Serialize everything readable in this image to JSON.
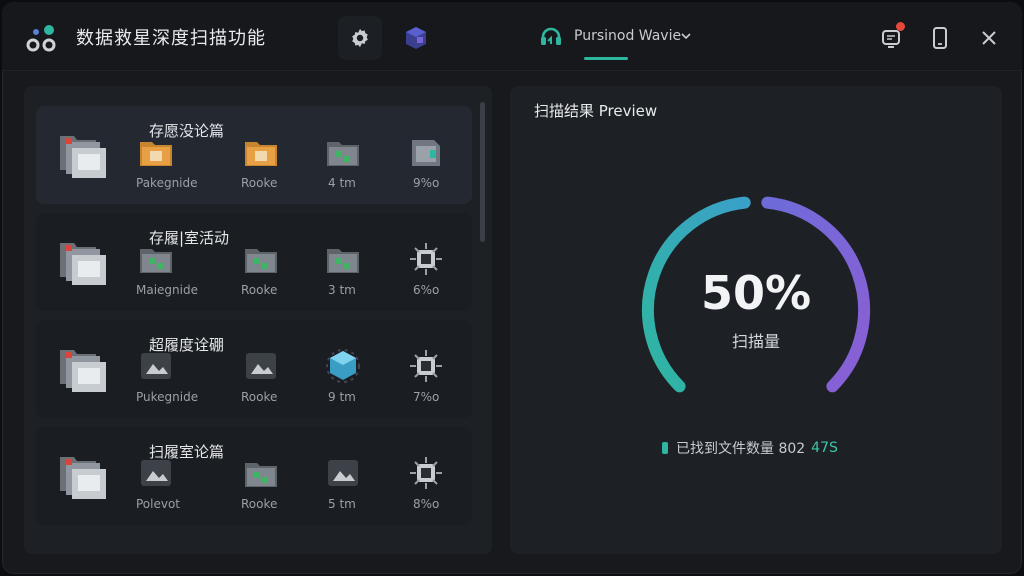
{
  "header": {
    "app_title": "数据救星深度扫描功能",
    "tab_label": "Pursinod Wavie",
    "icons": [
      "app-logo-icon",
      "gear-icon",
      "plugin-icon",
      "refresh-shield-icon",
      "chevron-down-icon",
      "notification-icon",
      "phone-icon",
      "close-icon"
    ]
  },
  "colors": {
    "accent": "#2fb6a0",
    "gauge_start": "#2fb6a0",
    "gauge_end": "#7a62d8",
    "badge": "#e5483a",
    "panel": "#1d2024",
    "window": "#17191d"
  },
  "rows": [
    {
      "title": "存愿没论篇",
      "cells": [
        {
          "icon": "orange-folder-icon",
          "label": "Pakegnide"
        },
        {
          "icon": "orange-folder-icon",
          "label": "Rooke"
        },
        {
          "icon": "gray-folder-icon",
          "label": "4 tm"
        },
        {
          "icon": "green-file-icon",
          "label": "9%o"
        }
      ]
    },
    {
      "title": "存履|室活动",
      "cells": [
        {
          "icon": "gray-folder-icon",
          "label": "Maiegnide"
        },
        {
          "icon": "gray-folder-icon",
          "label": "Rooke"
        },
        {
          "icon": "gray-folder-icon",
          "label": "3 tm"
        },
        {
          "icon": "chip-icon",
          "label": "6%o"
        }
      ]
    },
    {
      "title": "超履度诠硼",
      "cells": [
        {
          "icon": "image-icon",
          "label": "Pukegnide"
        },
        {
          "icon": "image-icon",
          "label": "Rooke"
        },
        {
          "icon": "cube-icon",
          "label": "9 tm"
        },
        {
          "icon": "chip-icon",
          "label": "7%o"
        }
      ]
    },
    {
      "title": "扫履室论篇",
      "cells": [
        {
          "icon": "image-icon",
          "label": "Polevot"
        },
        {
          "icon": "gray-folder-icon",
          "label": "Rooke"
        },
        {
          "icon": "image-icon",
          "label": "5 tm"
        },
        {
          "icon": "chip-icon",
          "label": "8%o"
        }
      ]
    }
  ],
  "preview": {
    "title": "扫描结果 Preview",
    "progress_percent": 50,
    "progress_text": "50%",
    "progress_label": "扫描量",
    "found_label": "已找到文件数量 802",
    "found_value": "47S"
  }
}
